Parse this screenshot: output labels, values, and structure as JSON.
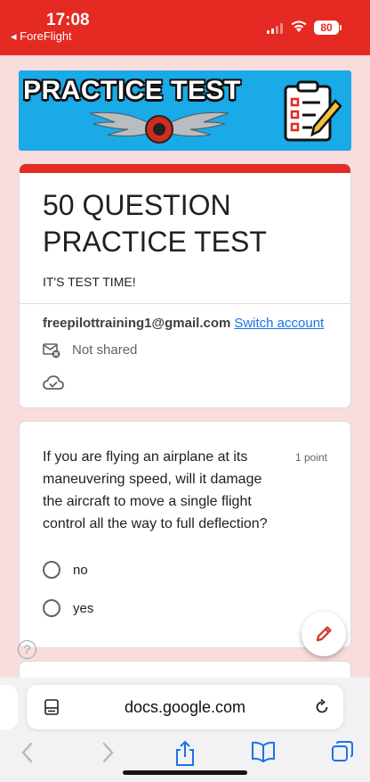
{
  "status_bar": {
    "time": "17:08",
    "back_app": "◂ ForeFlight",
    "battery": "80"
  },
  "banner": {
    "title": "PRACTICE TEST",
    "colors": {
      "background": "#19aae7",
      "accent": "#e42a22"
    }
  },
  "form": {
    "title": "50 QUESTION PRACTICE TEST",
    "description": "IT'S TEST TIME!",
    "account_email": "freepilottraining1@gmail.com",
    "switch_account": "Switch account",
    "not_shared": "Not shared"
  },
  "question": {
    "text": "If you are flying an airplane at its maneuvering speed, will it damage the aircraft to move a single flight control all the way to full deflection?",
    "points": "1 point",
    "options": [
      "no",
      "yes"
    ]
  },
  "help": "?",
  "browser": {
    "url": "docs.google.com"
  },
  "icons": [
    "reader-icon",
    "reload-icon",
    "back-icon",
    "forward-icon",
    "share-icon",
    "bookmarks-icon",
    "tabs-icon",
    "edit-icon",
    "cloud-icon",
    "mail-off-icon"
  ]
}
